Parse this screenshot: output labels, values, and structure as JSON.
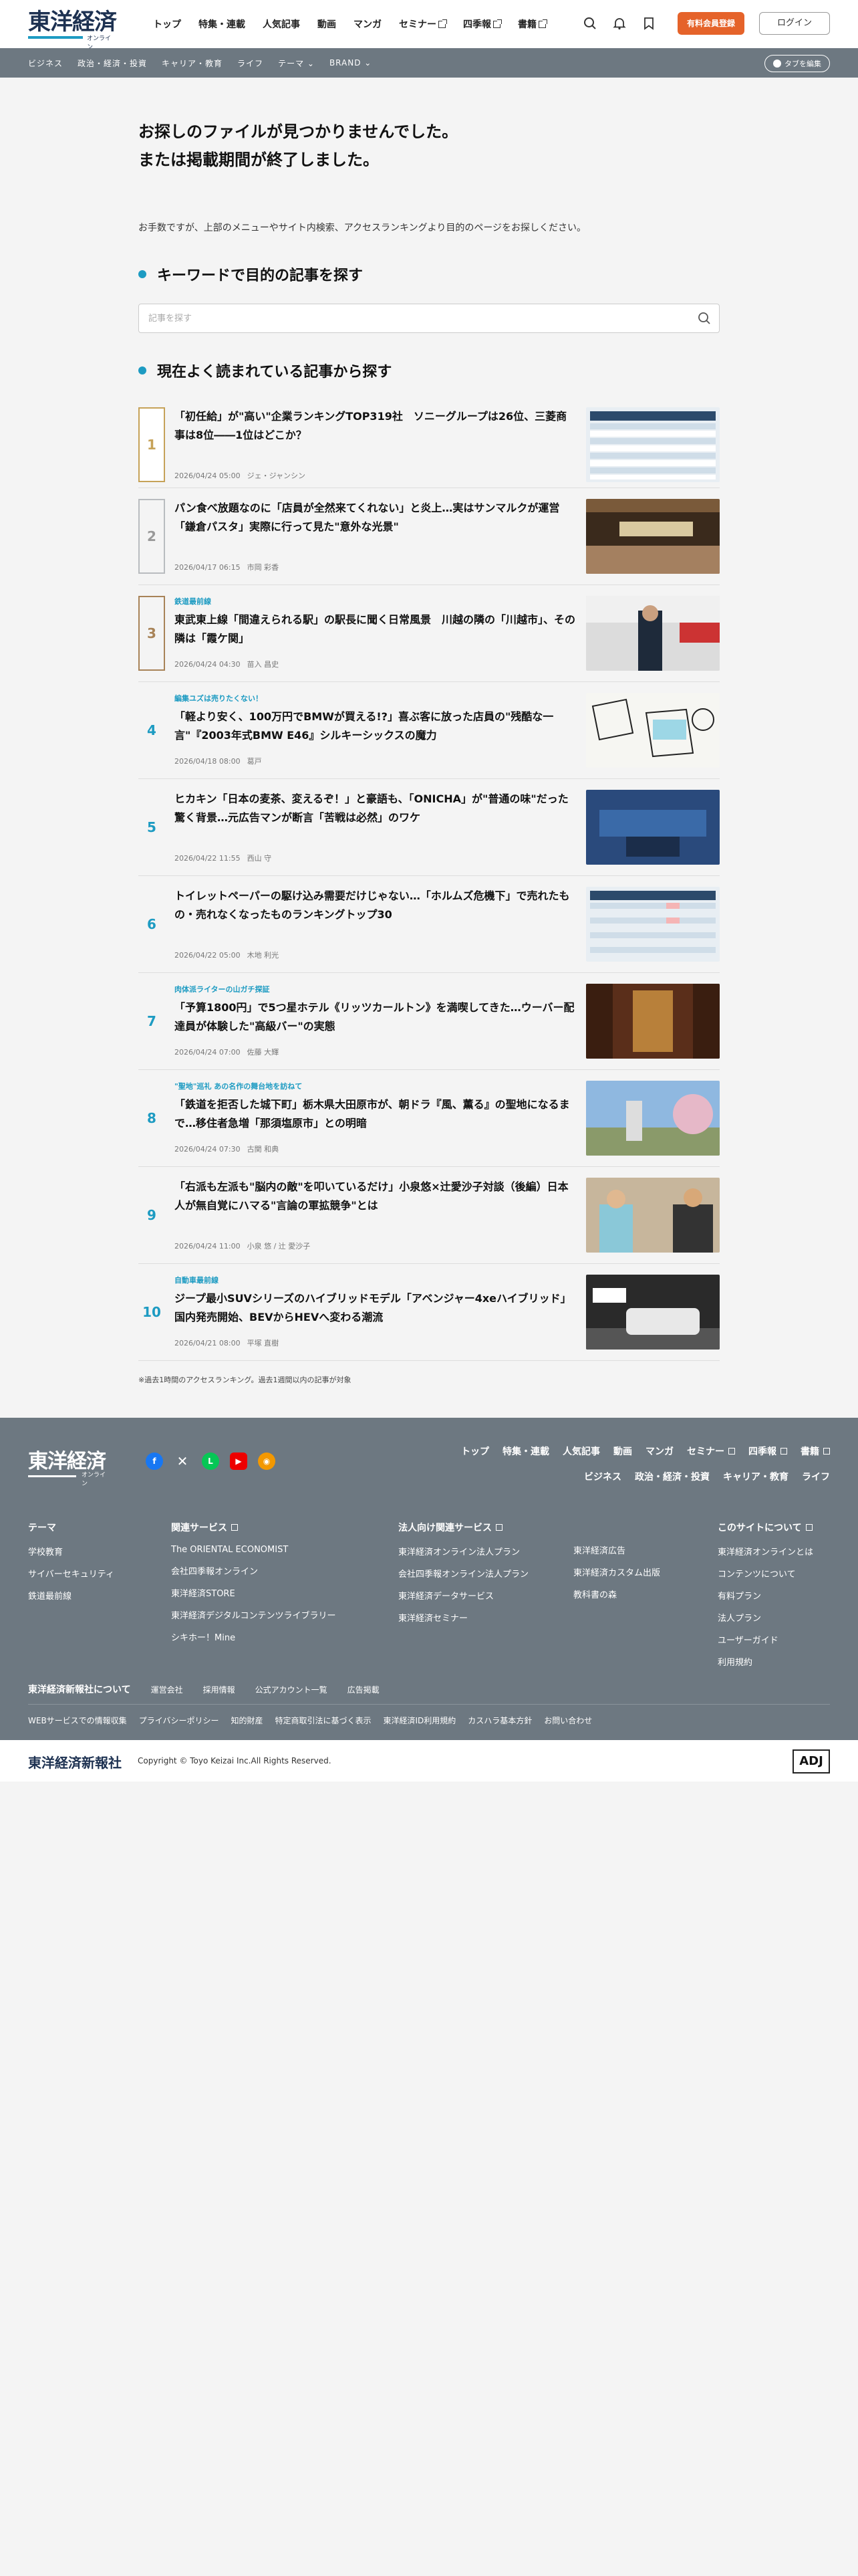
{
  "header": {
    "logo": "東洋経済",
    "logo_sub": "オンライン",
    "nav": [
      "トップ",
      "特集・連載",
      "人気記事",
      "動画",
      "マンガ",
      "セミナー",
      "四季報",
      "書籍"
    ],
    "subscribe_label": "有料会員登録",
    "login_label": "ログイン"
  },
  "subnav": {
    "items": [
      "ビジネス",
      "政治・経済・投資",
      "キャリア・教育",
      "ライフ",
      "テーマ ⌄",
      "BRAND ⌄"
    ],
    "tab_edit_label": "タブを編集"
  },
  "main": {
    "error_line1": "お探しのファイルが見つかりませんでした。",
    "error_line2": "または掲載期間が終了しました。",
    "error_msg": "お手数ですが、上部のメニューやサイト内検索、アクセスランキングより目的のページをお探しください。",
    "keyword_heading": "キーワードで目的の記事を探す",
    "search_placeholder": "記事を探す",
    "ranking_heading": "現在よく読まれている記事から探す",
    "note": "※過去1時間のアクセスランキング。過去1週間以内の記事が対象"
  },
  "ranking": [
    {
      "rank": "1",
      "category": "",
      "title": "「初任給」が\"高い\"企業ランキングTOP319社　ソニーグループは26位、三菱商事は8位――1位はどこか？",
      "date": "2026/04/24 05:00",
      "author": "ジェ・ジャンシン"
    },
    {
      "rank": "2",
      "category": "",
      "title": "パン食べ放題なのに「店員が全然来てくれない」と炎上…実はサンマルクが運営「鎌倉パスタ」実際に行って見た\"意外な光景\"",
      "date": "2026/04/17 06:15",
      "author": "市岡 彩香"
    },
    {
      "rank": "3",
      "category": "鉄道最前線",
      "title": "東武東上線「間違えられる駅」の駅長に聞く日常風景　川越の隣の「川越市」、その隣は「霞ケ関」",
      "date": "2026/04/24 04:30",
      "author": "苗入 昌史"
    },
    {
      "rank": "4",
      "category": "編集ユズは売りたくない！",
      "title": "「軽より安く、100万円でBMWが買える!?」喜ぶ客に放った店員の\"残酷な一言\"『2003年式BMW E46』シルキーシックスの魔力",
      "date": "2026/04/18 08:00",
      "author": "葛戸"
    },
    {
      "rank": "5",
      "category": "",
      "title": "ヒカキン「日本の麦茶、変えるぞ！」と豪語も、「ONICHA」が\"普通の味\"だった驚く背景…元広告マンが断言「苦戦は必然」のワケ",
      "date": "2026/04/22 11:55",
      "author": "西山 守"
    },
    {
      "rank": "6",
      "category": "",
      "title": "トイレットペーパーの駆け込み需要だけじゃない…「ホルムズ危機下」で売れたもの・売れなくなったものランキングトップ30",
      "date": "2026/04/22 05:00",
      "author": "木地 利光"
    },
    {
      "rank": "7",
      "category": "肉体派ライターの山ガチ探証",
      "title": "「予算1800円」で5つ星ホテル《リッツカールトン》を満喫してきた…ウーバー配達員が体験した\"高級バー\"の実態",
      "date": "2026/04/24 07:00",
      "author": "佐藤 大輝"
    },
    {
      "rank": "8",
      "category": "\"聖地\"巡礼 あの名作の舞台地を訪ねて",
      "title": "「鉄道を拒否した城下町」栃木県大田原市が、朝ドラ『風、薫る』の聖地になるまで…移住者急増「那須塩原市」との明暗",
      "date": "2026/04/24 07:30",
      "author": "古関 和典"
    },
    {
      "rank": "9",
      "category": "",
      "title": "「右派も左派も\"脳内の敵\"を叩いているだけ」小泉悠×辻愛沙子対談（後編）日本人が無自覚にハマる\"言論の軍拡競争\"とは",
      "date": "2026/04/24 11:00",
      "author": "小泉 悠 / 辻 愛沙子"
    },
    {
      "rank": "10",
      "category": "自動車最前線",
      "title": "ジープ最小SUVシリーズのハイブリッドモデル「アベンジャー4xeハイブリッド」国内発売開始、BEVからHEVへ変わる潮流",
      "date": "2026/04/21 08:00",
      "author": "平塚 直樹"
    }
  ],
  "footer": {
    "logo": "東洋経済",
    "logo_sub": "オンライン",
    "nav1": [
      "トップ",
      "特集・連載",
      "人気記事",
      "動画",
      "マンガ",
      "セミナー",
      "四季報",
      "書籍"
    ],
    "nav2": [
      "ビジネス",
      "政治・経済・投資",
      "キャリア・教育",
      "ライフ"
    ],
    "theme_heading": "テーマ",
    "theme_links": [
      "学校教育",
      "サイバーセキュリティ",
      "鉄道最前線"
    ],
    "related_heading": "関連サービス",
    "related_links": [
      "The ORIENTAL ECONOMIST",
      "会社四季報オンライン",
      "東洋経済STORE",
      "東洋経済デジタルコンテンツライブラリー",
      "シキホー！Mine"
    ],
    "corp_heading": "法人向け関連サービス",
    "corp_links_a": [
      "東洋経済オンライン法人プラン",
      "会社四季報オンライン法人プラン",
      "東洋経済データサービス",
      "東洋経済セミナー"
    ],
    "corp_links_b": [
      "東洋経済広告",
      "東洋経済カスタム出版",
      "教科書の森"
    ],
    "about_heading": "このサイトについて",
    "about_links": [
      "東洋経済オンラインとは",
      "コンテンツについて",
      "有料プラン",
      "法人プラン",
      "ユーザーガイド",
      "利用規約"
    ],
    "company_heading": "東洋経済新報社について",
    "company_links": [
      "運営会社",
      "採用情報",
      "公式アカウント一覧",
      "広告掲載"
    ],
    "policy_links": [
      "WEBサービスでの情報収集",
      "プライバシーポリシー",
      "知的財産",
      "特定商取引法に基づく表示",
      "東洋経済ID利用規約",
      "カスハラ基本方針",
      "お問い合わせ"
    ]
  },
  "bottom": {
    "company": "東洋経済新報社",
    "copyright": "Copyright © Toyo Keizai Inc.All Rights Reserved.",
    "adj": "ADJ"
  },
  "colors": {
    "accent": "#1d9bc2",
    "brand": "#1d3151",
    "subscribe": "#e5632a",
    "footer": "#6d7881"
  }
}
